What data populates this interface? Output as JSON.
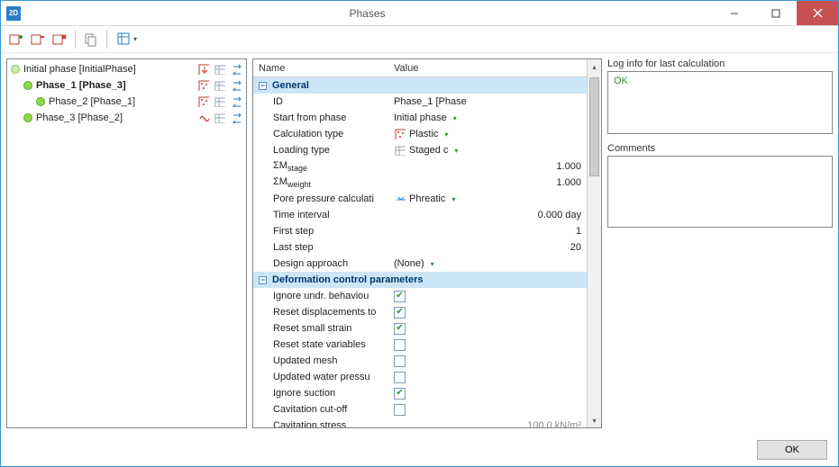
{
  "window": {
    "title": "Phases",
    "app_badge": "2D"
  },
  "phases": {
    "items": [
      {
        "label": "Initial phase [InitialPhase]",
        "selected": false,
        "indent": 0,
        "right_icons": [
          "gravity",
          "table",
          "arrows"
        ]
      },
      {
        "label": "Phase_1 [Phase_3]",
        "selected": true,
        "indent": 1,
        "right_icons": [
          "plastic",
          "table",
          "arrows"
        ]
      },
      {
        "label": "Phase_2 [Phase_1]",
        "selected": false,
        "indent": 2,
        "right_icons": [
          "plastic",
          "table",
          "arrows"
        ]
      },
      {
        "label": "Phase_3 [Phase_2]",
        "selected": false,
        "indent": 1,
        "right_icons": [
          "dynamic",
          "table",
          "arrows"
        ]
      }
    ]
  },
  "properties": {
    "headers": {
      "name": "Name",
      "value": "Value"
    },
    "sections": [
      {
        "title": "General",
        "rows": [
          {
            "name": "ID",
            "value": "Phase_1 [Phase",
            "type": "text"
          },
          {
            "name": "Start from phase",
            "value": "Initial phase",
            "type": "dropdown"
          },
          {
            "name": "Calculation type",
            "value": "Plastic",
            "type": "dropdown",
            "icon": "plastic"
          },
          {
            "name": "Loading type",
            "value": "Staged c",
            "type": "dropdown",
            "icon": "table"
          },
          {
            "name": "ΣM_stage",
            "value": "1.000",
            "type": "number"
          },
          {
            "name": "ΣM_weight",
            "value": "1.000",
            "type": "number"
          },
          {
            "name": "Pore pressure calculati",
            "value": "Phreatic",
            "type": "dropdown",
            "icon": "phreatic"
          },
          {
            "name": "Time interval",
            "value": "0.000 day",
            "type": "number"
          },
          {
            "name": "First step",
            "value": "1",
            "type": "number"
          },
          {
            "name": "Last step",
            "value": "20",
            "type": "number"
          },
          {
            "name": "Design approach",
            "value": "(None)",
            "type": "dropdown"
          }
        ]
      },
      {
        "title": "Deformation control parameters",
        "rows": [
          {
            "name": "Ignore undr. behaviou",
            "type": "checkbox",
            "checked": true
          },
          {
            "name": "Reset displacements to",
            "type": "checkbox",
            "checked": true
          },
          {
            "name": "Reset small strain",
            "type": "checkbox",
            "checked": true
          },
          {
            "name": "Reset state variables",
            "type": "checkbox",
            "checked": false
          },
          {
            "name": "Updated mesh",
            "type": "checkbox",
            "checked": false
          },
          {
            "name": "Updated water pressu",
            "type": "checkbox",
            "checked": false
          },
          {
            "name": "Ignore suction",
            "type": "checkbox",
            "checked": true
          },
          {
            "name": "Cavitation cut-off",
            "type": "checkbox",
            "checked": false
          },
          {
            "name": "Cavitation stress",
            "value": "100.0 kN/m²",
            "type": "number",
            "muted": true
          }
        ]
      }
    ]
  },
  "right": {
    "log_label": "Log info for last calculation",
    "log_value": "OK",
    "comments_label": "Comments",
    "comments_value": ""
  },
  "buttons": {
    "ok": "OK"
  },
  "icons": {
    "search": "",
    "gear": ""
  }
}
